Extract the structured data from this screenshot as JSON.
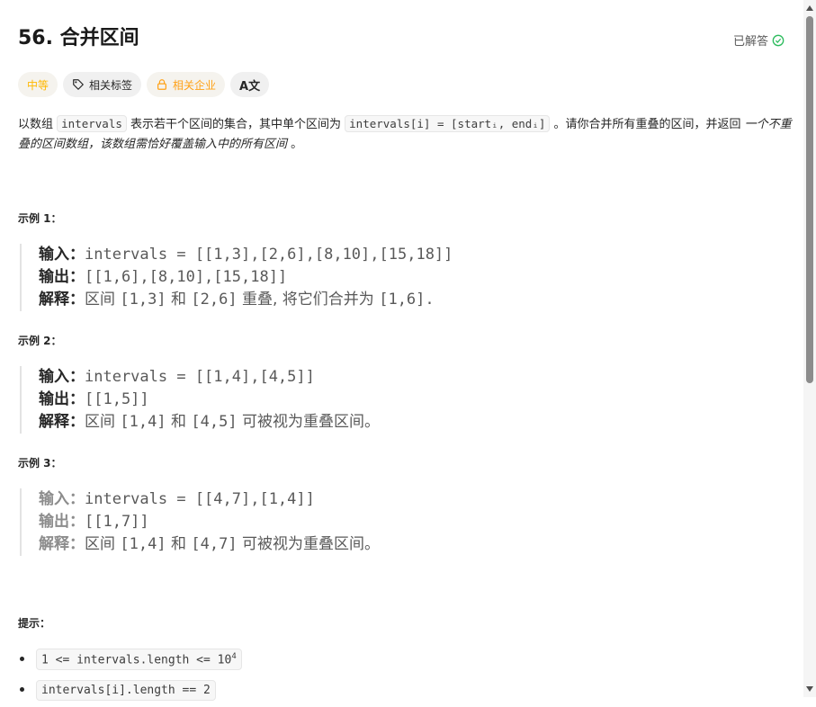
{
  "problem": {
    "title": "56. 合并区间",
    "solved_label": "已解答",
    "difficulty": "中等",
    "related_tags": "相关标签",
    "related_companies": "相关企业",
    "translate_icon_label": "A文"
  },
  "description": {
    "p1_a": "以数组 ",
    "p1_code1": "intervals",
    "p1_b": " 表示若干个区间的集合，其中单个区间为 ",
    "p1_code2": "intervals[i] = [startᵢ, endᵢ]",
    "p1_c": " 。请你合并所有重叠的区间，并返回 ",
    "p1_em": "一个不重叠的区间数组，该数组需恰好覆盖输入中的所有区间",
    "p1_d": " 。"
  },
  "examples": [
    {
      "heading": "示例 1：",
      "input_label": "输入：",
      "input": "intervals = [[1,3],[2,6],[8,10],[15,18]]",
      "output_label": "输出：",
      "output": "[[1,6],[8,10],[15,18]]",
      "explain_label": "解释：",
      "explain_a": "区间 ",
      "explain_code1": "[1,3]",
      "explain_b": " 和 ",
      "explain_code2": "[2,6]",
      "explain_c": " 重叠, 将它们合并为 ",
      "explain_code3": "[1,6]",
      "explain_d": "."
    },
    {
      "heading": "示例 2：",
      "input_label": "输入：",
      "input": "intervals = [[1,4],[4,5]]",
      "output_label": "输出：",
      "output": "[[1,5]]",
      "explain_label": "解释：",
      "explain_a": "区间 ",
      "explain_code1": "[1,4]",
      "explain_b": " 和 ",
      "explain_code2": "[4,5]",
      "explain_c": " 可被视为重叠区间。"
    },
    {
      "heading": "示例 3：",
      "input_label": "输入：",
      "input": "intervals = [[4,7],[1,4]]",
      "output_label": "输出：",
      "output": "[[1,7]]",
      "explain_label": "解释：",
      "explain_a": "区间 ",
      "explain_code1": "[1,4]",
      "explain_b": " 和 ",
      "explain_code2": "[4,7]",
      "explain_c": " 可被视为重叠区间。"
    }
  ],
  "hints": {
    "heading": "提示：",
    "h1_code": "1 <= intervals.length <= 10",
    "h1_sup": "4",
    "h2_code": "intervals[i].length == 2"
  },
  "colors": {
    "difficulty": "#ffb800",
    "company": "#ffa116",
    "solved_check": "#2cbb5d"
  }
}
